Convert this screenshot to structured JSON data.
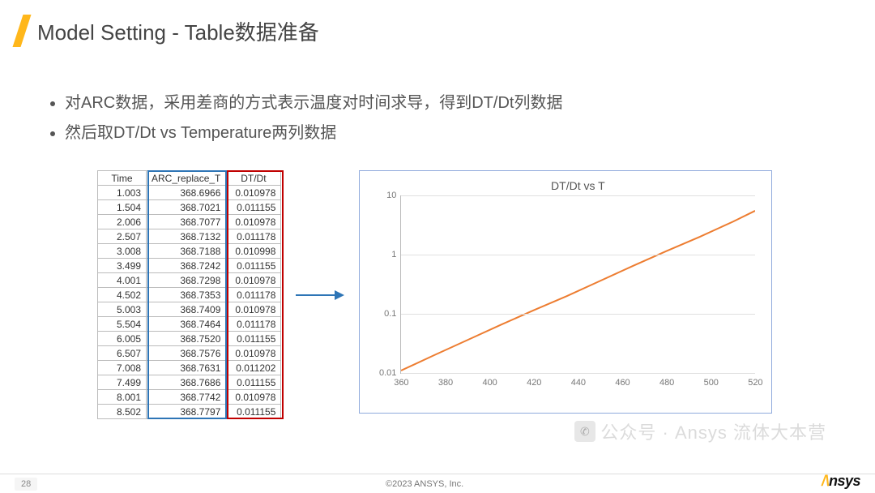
{
  "title": "Model Setting - Table数据准备",
  "bullets": [
    "对ARC数据，采用差商的方式表示温度对时间求导，得到DT/Dt列数据",
    "然后取DT/Dt vs Temperature两列数据"
  ],
  "table": {
    "headers": [
      "Time",
      "ARC_replace_T",
      "DT/Dt"
    ],
    "rows": [
      [
        "1.003",
        "368.6966",
        "0.010978"
      ],
      [
        "1.504",
        "368.7021",
        "0.011155"
      ],
      [
        "2.006",
        "368.7077",
        "0.010978"
      ],
      [
        "2.507",
        "368.7132",
        "0.011178"
      ],
      [
        "3.008",
        "368.7188",
        "0.010998"
      ],
      [
        "3.499",
        "368.7242",
        "0.011155"
      ],
      [
        "4.001",
        "368.7298",
        "0.010978"
      ],
      [
        "4.502",
        "368.7353",
        "0.011178"
      ],
      [
        "5.003",
        "368.7409",
        "0.010978"
      ],
      [
        "5.504",
        "368.7464",
        "0.011178"
      ],
      [
        "6.005",
        "368.7520",
        "0.011155"
      ],
      [
        "6.507",
        "368.7576",
        "0.010978"
      ],
      [
        "7.008",
        "368.7631",
        "0.011202"
      ],
      [
        "7.499",
        "368.7686",
        "0.011155"
      ],
      [
        "8.001",
        "368.7742",
        "0.010978"
      ],
      [
        "8.502",
        "368.7797",
        "0.011155"
      ]
    ]
  },
  "chart_data": {
    "type": "line",
    "title": "DT/Dt vs T",
    "xlabel": "",
    "ylabel": "",
    "xlim": [
      360,
      520
    ],
    "ylim_log10": [
      -2,
      1
    ],
    "yticks": [
      "0.01",
      "0.1",
      "1",
      "10"
    ],
    "xticks": [
      "360",
      "380",
      "400",
      "420",
      "440",
      "460",
      "480",
      "500",
      "520"
    ],
    "series": [
      {
        "name": "DT/Dt",
        "color": "#ed7d31",
        "x": [
          360,
          375,
          390,
          405,
          420,
          435,
          450,
          465,
          480,
          495,
          510,
          520
        ],
        "y": [
          0.011,
          0.02,
          0.036,
          0.065,
          0.115,
          0.2,
          0.36,
          0.65,
          1.15,
          2.0,
          3.6,
          5.5
        ]
      }
    ]
  },
  "footer": {
    "page": "28",
    "copyright": "©2023 ANSYS, Inc."
  },
  "logo": {
    "brand": "nsys"
  },
  "watermark": "公众号 · Ansys 流体大本营"
}
